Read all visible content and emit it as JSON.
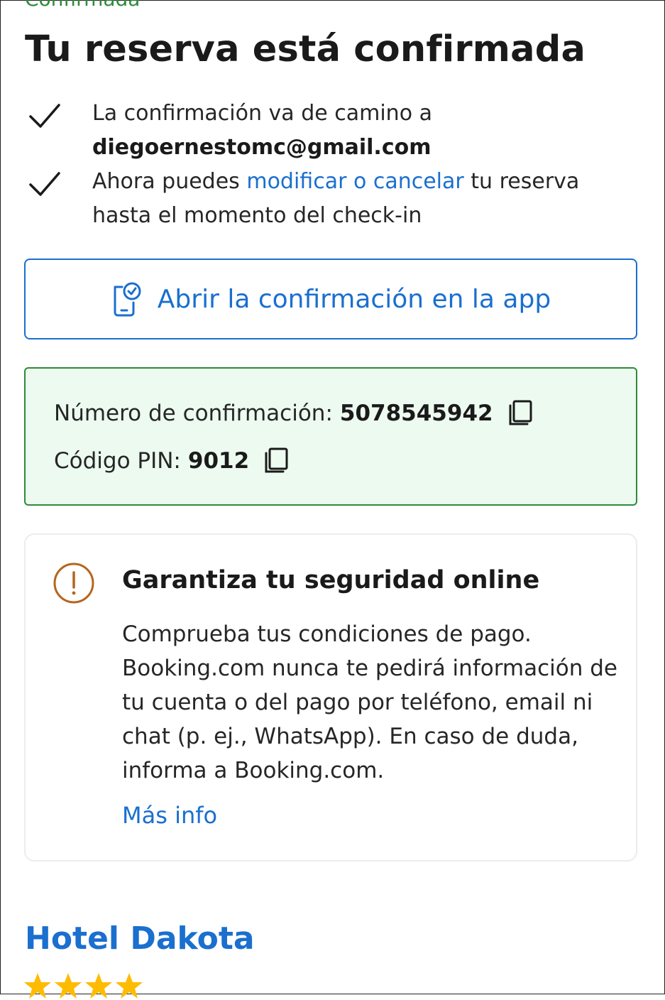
{
  "header": {
    "status_label": "Confirmada",
    "title": "Tu reserva está confirmada"
  },
  "checks": {
    "email_text": "La confirmación va de camino a",
    "email": "diegoernestomc@gmail.com",
    "modify_prefix": "Ahora puedes",
    "modify_link": "modificar o cancelar",
    "modify_suffix": "tu reserva hasta el momento del check-in"
  },
  "app_button": {
    "label": "Abrir la confirmación en la app",
    "icon": "phone-check-icon"
  },
  "confirmation": {
    "number_label": "Número de confirmación:",
    "number": "5078545942",
    "pin_label": "Código PIN:",
    "pin": "9012",
    "copy_icon": "copy-icon"
  },
  "safety": {
    "icon": "alert-circle-icon",
    "heading": "Garantiza tu seguridad online",
    "body": "Comprueba tus condiciones de pago. Booking.com nunca te pedirá información de tu cuenta o del pago por teléfono, email ni chat (p. ej., WhatsApp). En caso de duda, informa a Booking.com.",
    "more_link": "Más info"
  },
  "hotel": {
    "name": "Hotel Dakota",
    "stars": 4
  },
  "colors": {
    "link": "#1a6fcf",
    "success_border": "#2e8b3a",
    "success_bg": "#ecfaef",
    "alert": "#b5651d",
    "star": "#febb02"
  }
}
